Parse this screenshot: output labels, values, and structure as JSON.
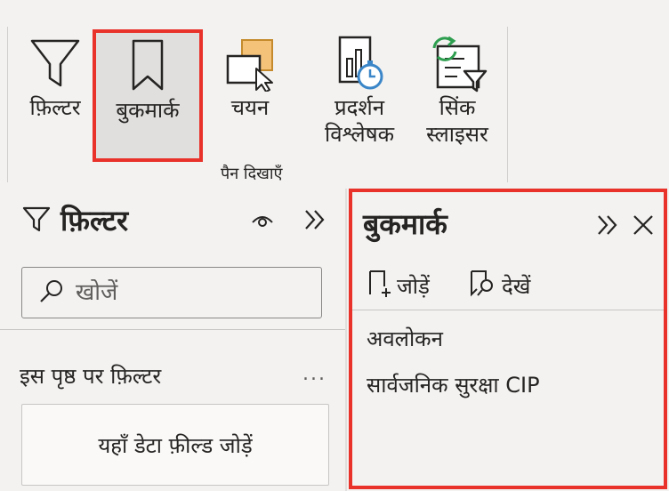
{
  "ribbon": {
    "buttons": {
      "filter": "फ़िल्टर",
      "bookmark": "बुकमार्क",
      "selection": "चयन",
      "perf_line1": "प्रदर्शन",
      "perf_line2": "विश्लेषक",
      "sync_line1": "सिंक",
      "sync_line2": "स्लाइसर"
    },
    "active_button": "bookmark",
    "group_label": "पैन दिखाएँ"
  },
  "filter_pane": {
    "title": "फ़िल्टर",
    "search_placeholder": "खोजें",
    "section_title": "इस पृष्ठ पर फ़िल्टर",
    "more_label": "...",
    "drop_well_text": "यहाँ डेटा फ़ील्ड जोड़ें"
  },
  "bookmark_pane": {
    "title": "बुकमार्क",
    "add_label": "जोड़ें",
    "view_label": "देखें",
    "items": [
      "अवलोकन",
      "सार्वजनिक सुरक्षा CIP"
    ]
  },
  "colors": {
    "highlight_border": "#e8322a",
    "background": "#f3f2f1",
    "text": "#252423",
    "accent_blue": "#3a86c8",
    "accent_green": "#2e9e4f",
    "accent_orange": "#f5c27a"
  }
}
